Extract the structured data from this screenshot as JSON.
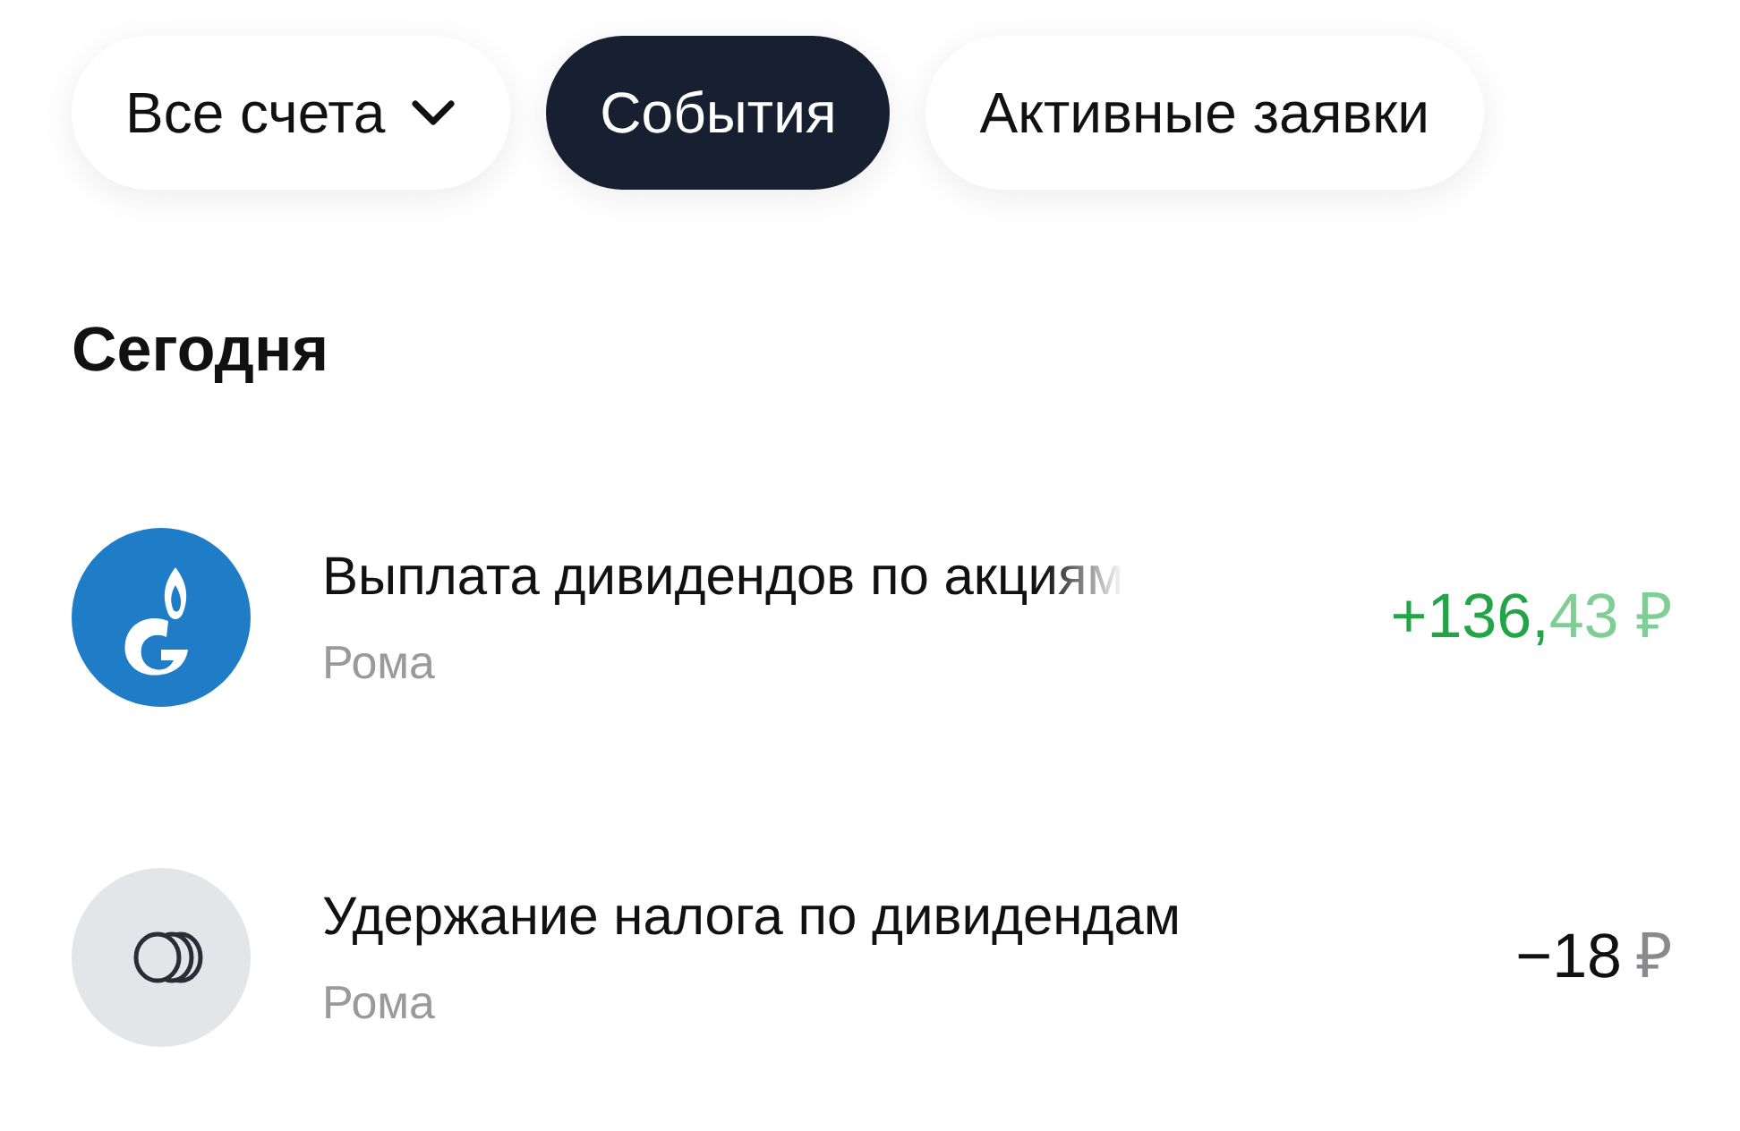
{
  "filters": [
    {
      "label": "Все счета",
      "kind": "dropdown",
      "selected": false
    },
    {
      "label": "События",
      "kind": "tab",
      "selected": true
    },
    {
      "label": "Активные заявки",
      "kind": "tab",
      "selected": false
    }
  ],
  "section_title": "Сегодня",
  "events": [
    {
      "title": "Выплата дивидендов по акциям",
      "title_faded": true,
      "subtitle": "Рома",
      "amount_main": "+136,",
      "amount_minor": "43 ₽",
      "kind": "income"
    },
    {
      "title": "Удержание налога по дивидендам",
      "title_faded": false,
      "subtitle": "Рома",
      "amount_main": "−18",
      "amount_minor": "₽",
      "kind": "expense"
    }
  ]
}
